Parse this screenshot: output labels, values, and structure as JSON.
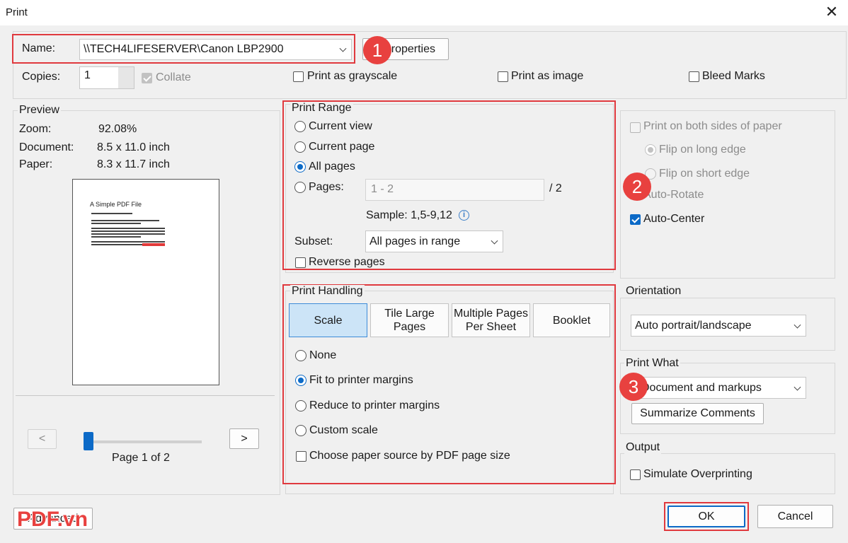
{
  "window": {
    "title": "Print"
  },
  "printer": {
    "name_label": "Name:",
    "name_value": "\\\\TECH4LIFESERVER\\Canon LBP2900",
    "properties_label": "Properties",
    "badge": "1"
  },
  "copies": {
    "label": "Copies:",
    "value": "1",
    "collate_label": "Collate"
  },
  "options": {
    "grayscale": "Print as grayscale",
    "as_image": "Print as image",
    "bleed_marks": "Bleed Marks"
  },
  "preview": {
    "legend": "Preview",
    "zoom_label": "Zoom:",
    "zoom_value": "92.08%",
    "document_label": "Document:",
    "document_value": "8.5 x 11.0 inch",
    "paper_label": "Paper:",
    "paper_value": "8.3 x 11.7 inch",
    "page_title": "A Simple PDF File",
    "prev": "<",
    "next": ">",
    "page_indicator": "Page 1 of 2",
    "slider_fraction": 0.0
  },
  "print_range": {
    "legend": "Print Range",
    "current_view": "Current view",
    "current_page": "Current page",
    "all_pages": "All pages",
    "pages_label": "Pages:",
    "pages_placeholder": "1 - 2",
    "pages_total": "/ 2",
    "sample": "Sample: 1,5-9,12",
    "subset_label": "Subset:",
    "subset_value": "All pages in range",
    "reverse": "Reverse pages"
  },
  "duplex": {
    "both_sides": "Print on both sides of paper",
    "long_edge": "Flip on long edge",
    "short_edge": "Flip on short edge",
    "auto_rotate": "Auto-Rotate",
    "auto_center": "Auto-Center",
    "badge": "2"
  },
  "print_handling": {
    "legend": "Print Handling",
    "tabs": [
      {
        "label": "Scale"
      },
      {
        "label": "Tile Large Pages"
      },
      {
        "label": "Multiple Pages Per Sheet"
      },
      {
        "label": "Booklet"
      }
    ],
    "none": "None",
    "fit": "Fit to printer margins",
    "reduce": "Reduce to printer margins",
    "custom": "Custom scale",
    "paper_source": "Choose paper source by PDF page size",
    "badge": "3"
  },
  "orientation": {
    "legend": "Orientation",
    "value": "Auto portrait/landscape"
  },
  "print_what": {
    "legend": "Print What",
    "value": "Document and markups",
    "summarize": "Summarize Comments"
  },
  "output": {
    "legend": "Output",
    "simulate": "Simulate Overprinting"
  },
  "footer": {
    "advanced": "Advanced",
    "ok": "OK",
    "cancel": "Cancel",
    "watermark": "PDF.vn"
  },
  "colors": {
    "accent": "#0c6ac7",
    "highlight": "#e0393e",
    "badge": "#e8413f"
  }
}
